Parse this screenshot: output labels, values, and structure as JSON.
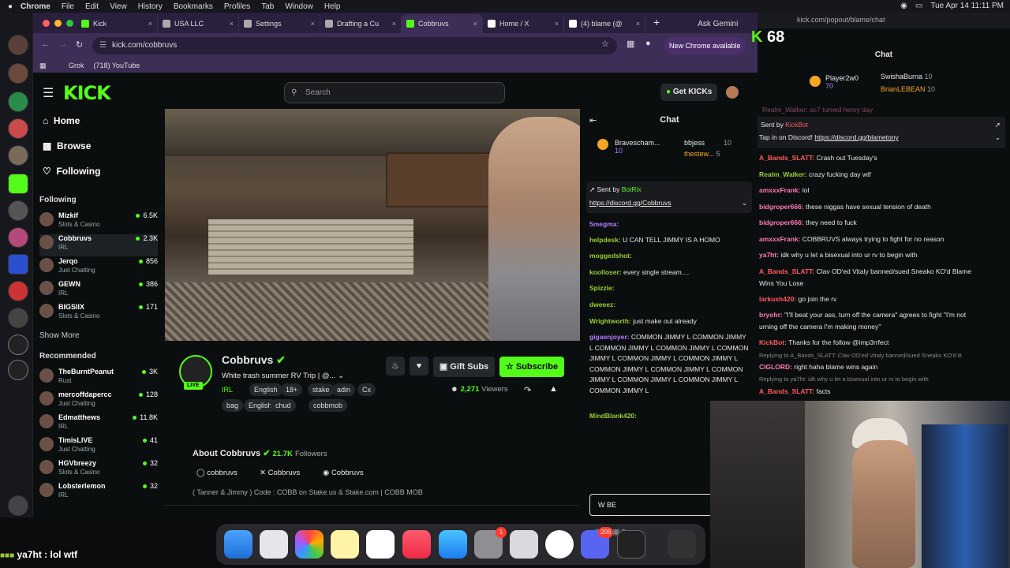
{
  "menubar": {
    "items": [
      "Chrome",
      "File",
      "Edit",
      "View",
      "History",
      "Bookmarks",
      "Profiles",
      "Tab",
      "Window",
      "Help"
    ],
    "clock": "Tue Apr 14  11:11 PM"
  },
  "tabs": [
    {
      "label": "Kick",
      "color": "#53fc18"
    },
    {
      "label": "USA LLC",
      "color": "#aaa"
    },
    {
      "label": "Settings",
      "color": "#aaa"
    },
    {
      "label": "Drafting a Cu",
      "color": "#aaa"
    },
    {
      "label": "Cobbruvs",
      "color": "#53fc18"
    },
    {
      "label": "Home / X",
      "color": "#fff"
    },
    {
      "label": "(4) blame (@",
      "color": "#fff"
    }
  ],
  "ask_gemini": "Ask Gemini",
  "url": "kick.com/cobbruvs",
  "new_chrome": "New Chrome available",
  "bookmarks": [
    "Grok",
    "(718) YouTube"
  ],
  "popup_overlay_count": "68",
  "kick": {
    "search_placeholder": "Search",
    "get_kicks": "Get KICKs",
    "nav": {
      "home": "Home",
      "browse": "Browse",
      "following": "Following"
    },
    "following_title": "Following",
    "following": [
      {
        "name": "Mizkif",
        "cat": "Slots & Casino",
        "viewers": "6.5K"
      },
      {
        "name": "Cobbruvs",
        "cat": "IRL",
        "viewers": "2.3K"
      },
      {
        "name": "Jerqo",
        "cat": "Just Chatting",
        "viewers": "856"
      },
      {
        "name": "GEWN",
        "cat": "IRL",
        "viewers": "386"
      },
      {
        "name": "BIGSIIX",
        "cat": "Slots & Casino",
        "viewers": "171"
      }
    ],
    "show_more": "Show More",
    "recommended_title": "Recommended",
    "recommended": [
      {
        "name": "TheBurntPeanut",
        "cat": "Rust",
        "viewers": "3K"
      },
      {
        "name": "mercoffdapercc",
        "cat": "Just Chatting",
        "viewers": "128"
      },
      {
        "name": "Edmatthews",
        "cat": "IRL",
        "viewers": "11.8K"
      },
      {
        "name": "TimisLIVE",
        "cat": "Just Chatting",
        "viewers": "41"
      },
      {
        "name": "HGVbreezy",
        "cat": "Slots & Casino",
        "viewers": "32"
      },
      {
        "name": "Lobsterlemon",
        "cat": "IRL",
        "viewers": "32"
      }
    ],
    "channel": {
      "name": "Cobbruvs",
      "title": "White trash summer RV Trip | @...",
      "live": "LIVE",
      "category": "IRL",
      "tags": [
        "English",
        "18+",
        "stake",
        "adin",
        "Cx",
        "bag",
        "English",
        "chud",
        "cobbmob"
      ],
      "gift": "Gift Subs",
      "subscribe": "Subscribe",
      "viewers": "2,271",
      "viewers_label": "Viewers",
      "about": "About Cobbruvs",
      "followers": "21.7K",
      "followers_label": "Followers",
      "socials": [
        "cobbruvs",
        "Cobbruvs",
        "Cobbruvs"
      ],
      "bio": "( Tanner & Jimmy ) Code : COBB on Stake.us & Stake.com | COBB MOB"
    },
    "chat": {
      "title": "Chat",
      "top": [
        {
          "name": "Bravescham...",
          "n": "10"
        },
        {
          "name": "bbjess",
          "n": "10"
        },
        {
          "name": "thestew...",
          "n": "5"
        }
      ],
      "pinned_by": "Sent by",
      "pinned_user": "BotRix",
      "pinned_link": "https://discord.gg/Cobbruvs",
      "messages": [
        {
          "u": "5megma:",
          "t": "",
          "c": "#b57cff"
        },
        {
          "u": "helpdesk:",
          "t": "U CAN TELL JIMMY IS A HOMO",
          "c": "#9acd32"
        },
        {
          "u": "moggedshot:",
          "t": "",
          "c": "#9acd32"
        },
        {
          "u": "koolloser:",
          "t": "every single stream....",
          "c": "#9acd32"
        },
        {
          "u": "Spizzle:",
          "t": "",
          "c": "#9acd32"
        },
        {
          "u": "dweeez:",
          "t": "",
          "c": "#9acd32"
        },
        {
          "u": "Wrightworth:",
          "t": "just make out already",
          "c": "#9acd32"
        },
        {
          "u": "gigaenjoyer:",
          "t": "COMMON JIMMY L COMMON JIMMY L COMMON JIMMY L COMMON JIMMY L COMMON JIMMY L COMMON JIMMY L COMMON JIMMY L COMMON JIMMY L COMMON JIMMY L COMMON JIMMY L COMMON JIMMY L COMMON JIMMY L COMMON JIMMY L",
          "c": "#b57cff"
        },
        {
          "u": "MindBlank420:",
          "t": "",
          "c": "#9acd32"
        }
      ],
      "input": "W BE",
      "points": "380",
      "zero": "0"
    }
  },
  "popup": {
    "url": "kick.com/popout/blame/chat",
    "title": "Chat",
    "top": [
      {
        "name": "Player2w0",
        "n": "70"
      },
      {
        "name": "SwishaBurna",
        "n": "10"
      },
      {
        "name": "BrianLEBEAN",
        "n": "10"
      }
    ],
    "clipped": "Realm_Walker: ac7 turned henry day",
    "pinned_by": "Sent by",
    "pinned_user": "KickBot",
    "pinned_text": "Tap in on Discord!",
    "pinned_link": "https://discord.gg/blametony",
    "messages": [
      {
        "u": "A_Bands_SLATT:",
        "t": "Crash out Tuesday's",
        "c": "#ff5a5a"
      },
      {
        "u": "Realm_Walker:",
        "t": "crazy fucking day wtf",
        "c": "#9acd32"
      },
      {
        "u": "amxxxFrank:",
        "t": "lol",
        "c": "#ff7ab6"
      },
      {
        "u": "bidgroper666:",
        "t": "these niggas have sexual tension of death",
        "c": "#ff7ab6"
      },
      {
        "u": "bidgroper666:",
        "t": "they need to fuck",
        "c": "#ff7ab6"
      },
      {
        "u": "amxxxFrank:",
        "t": "COBBRUVS always trying to fight for no reason",
        "c": "#ff7ab6"
      },
      {
        "u": "ya7ht:",
        "t": "idk why u let a bisexual into ur rv to begin with",
        "c": "#ff7ab6"
      },
      {
        "u": "A_Bands_SLATT:",
        "t": "Clav OD'ed Vitaly banned/sued Sneako KO'd Blame",
        "c": "#ff5a5a"
      },
      {
        "u": "",
        "t": "Wins You Lose",
        "c": "#ff5a5a"
      },
      {
        "u": "larkush420:",
        "t": "go join the rv",
        "c": "#ff5a5a"
      },
      {
        "u": "bryohr:",
        "t": "\"I'll beat your ass, turn off the camera\" agrees to fight \"I'm not",
        "c": "#ff7ab6"
      },
      {
        "u": "",
        "t": "urning off the camera I'm making money\"",
        "c": "#ff7ab6"
      },
      {
        "u": "KickBot:",
        "t": "Thanks for the follow @imp3rrfect",
        "c": "#ff5a5a"
      },
      {
        "u": "",
        "t": "Replying to A_Bands_SLATT: Clav OD'ed Vitaly banned/sued Sneako KO'd B",
        "c": "#888"
      },
      {
        "u": "CIGLORD:",
        "t": "right haha blame wins again",
        "c": "#ff7ab6"
      },
      {
        "u": "",
        "t": "Replying to ya7ht: idk why u let a bisexual into ur rv to begin with",
        "c": "#888"
      },
      {
        "u": "A_Bands_SLATT:",
        "t": "facts",
        "c": "#ff5a5a"
      }
    ]
  },
  "overlay_bottom_left": "ya7ht : lol wtf",
  "dock_badges": {
    "one": "1",
    "two": "206"
  }
}
